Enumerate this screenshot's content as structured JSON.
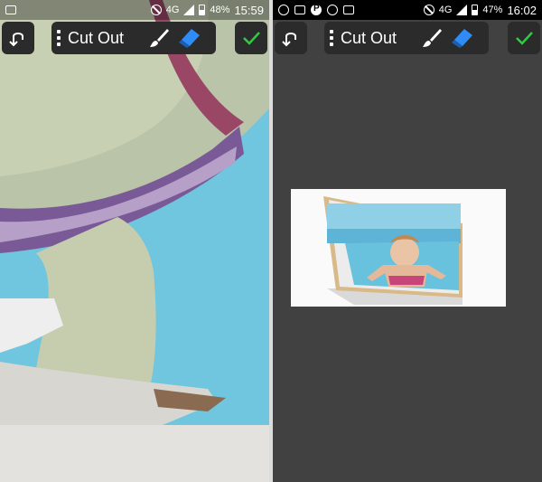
{
  "screens": [
    {
      "status_bar": {
        "network": "4G",
        "battery": "48%",
        "time": "15:59",
        "notifications": [
          "message-icon"
        ]
      },
      "toolbar": {
        "undo_icon": "undo-icon",
        "mode_label": "Cut Out",
        "brush_icon": "brush-icon",
        "eraser_icon": "eraser-icon",
        "confirm_icon": "checkmark-icon"
      },
      "canvas": {
        "content": "zoomed-swimmer-photo"
      }
    },
    {
      "status_bar": {
        "network": "4G",
        "battery": "47%",
        "time": "16:02",
        "notifications": [
          "wechat-icon",
          "message-icon",
          "pinterest-icon",
          "line-icon",
          "image-icon"
        ]
      },
      "toolbar": {
        "undo_icon": "undo-icon",
        "mode_label": "Cut Out",
        "brush_icon": "brush-icon",
        "eraser_icon": "eraser-icon",
        "confirm_icon": "checkmark-icon"
      },
      "canvas": {
        "content": "phone-frame-swimmer-photo"
      }
    }
  ],
  "colors": {
    "accent_green": "#2ecc40",
    "eraser_blue": "#2f8cf6",
    "toolbar_bg": "#2b2b2b",
    "canvas_bg": "#414141"
  }
}
